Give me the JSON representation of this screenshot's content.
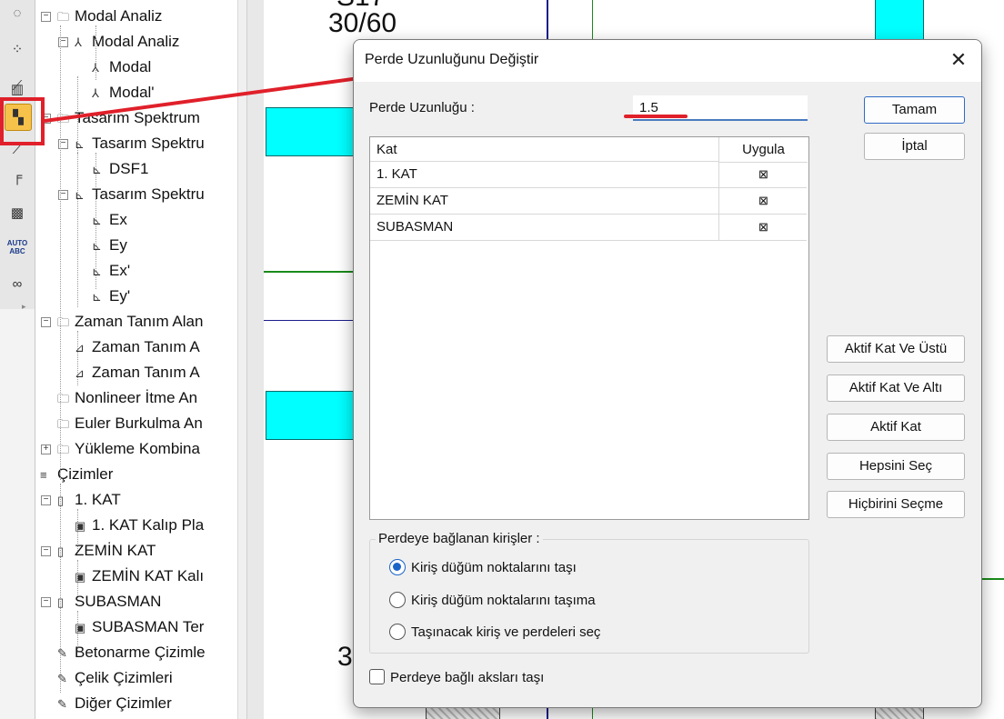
{
  "tree": [
    {
      "label": "Modal Analiz",
      "indent": 1,
      "icon": "folder-icon",
      "expander": "⊟"
    },
    {
      "label": "Modal Analiz",
      "indent": 2,
      "icon": "modal-icon",
      "expander": "⊟"
    },
    {
      "label": "Modal",
      "indent": 3,
      "icon": "modal-icon",
      "expander": ""
    },
    {
      "label": "Modal'",
      "indent": 3,
      "icon": "modal-icon",
      "expander": ""
    },
    {
      "label": "Tasarım Spektrum",
      "indent": 1,
      "icon": "folder-icon",
      "expander": "⊟"
    },
    {
      "label": "Tasarım Spektru",
      "indent": 2,
      "icon": "spectrum-icon",
      "expander": "⊟"
    },
    {
      "label": "DSF1",
      "indent": 3,
      "icon": "spectrum-icon",
      "expander": ""
    },
    {
      "label": "Tasarım Spektru",
      "indent": 2,
      "icon": "spectrum-icon",
      "expander": "⊟"
    },
    {
      "label": "Ex",
      "indent": 3,
      "icon": "spectrum-icon",
      "expander": ""
    },
    {
      "label": "Ey",
      "indent": 3,
      "icon": "spectrum-icon",
      "expander": ""
    },
    {
      "label": "Ex'",
      "indent": 3,
      "icon": "spectrum-icon",
      "expander": ""
    },
    {
      "label": "Ey'",
      "indent": 3,
      "icon": "spectrum-icon",
      "expander": ""
    },
    {
      "label": "Zaman Tanım Alan",
      "indent": 1,
      "icon": "folder-icon",
      "expander": "⊟"
    },
    {
      "label": "Zaman Tanım A",
      "indent": 2,
      "icon": "time-icon",
      "expander": ""
    },
    {
      "label": "Zaman Tanım A",
      "indent": 2,
      "icon": "time-icon",
      "expander": ""
    },
    {
      "label": "Nonlineer İtme An",
      "indent": 1,
      "icon": "folder-icon",
      "expander": ""
    },
    {
      "label": "Euler Burkulma An",
      "indent": 1,
      "icon": "folder-icon",
      "expander": ""
    },
    {
      "label": "Yükleme Kombina",
      "indent": 1,
      "icon": "folder-icon",
      "expander": "⊞"
    },
    {
      "label": "Çizimler",
      "indent": 0,
      "icon": "drawings-icon",
      "expander": "⊟"
    },
    {
      "label": "1. KAT",
      "indent": 1,
      "icon": "page-icon",
      "expander": "⊟"
    },
    {
      "label": "1. KAT Kalıp Pla",
      "indent": 2,
      "icon": "plan-icon",
      "expander": ""
    },
    {
      "label": "ZEMİN KAT",
      "indent": 1,
      "icon": "page-icon",
      "expander": "⊟"
    },
    {
      "label": "ZEMİN KAT Kalı",
      "indent": 2,
      "icon": "plan-icon",
      "expander": ""
    },
    {
      "label": "SUBASMAN",
      "indent": 1,
      "icon": "page-icon",
      "expander": "⊟"
    },
    {
      "label": "SUBASMAN Ter",
      "indent": 2,
      "icon": "plan-icon",
      "expander": ""
    },
    {
      "label": "Betonarme Çizimle",
      "indent": 1,
      "icon": "pen-icon",
      "expander": ""
    },
    {
      "label": "Çelik Çizimleri",
      "indent": 1,
      "icon": "pen-icon",
      "expander": ""
    },
    {
      "label": "Diğer Çizimler",
      "indent": 1,
      "icon": "pen-icon",
      "expander": ""
    }
  ],
  "canvas": {
    "label_top": "30/60",
    "label_top_partial": "S17",
    "label_bottom_partial": "3"
  },
  "toolbar": {
    "icons": [
      "orbit-icon",
      "nodes-icon",
      "scale-icon",
      "grid-icon",
      "wall-length-icon",
      "line-icon",
      "beam-icon",
      "tools-icon",
      "auto-abc-icon",
      "binoculars-icon"
    ],
    "auto_label": "AUTO ABC"
  },
  "dialog": {
    "title": "Perde Uzunluğunu Değiştir",
    "close_glyph": "✕",
    "length_label": "Perde Uzunluğu :",
    "length_value": "1.5",
    "list_header_kat": "Kat",
    "list_header_uygula": "Uygula",
    "rows": [
      {
        "kat": "1. KAT",
        "uygula": "⊠"
      },
      {
        "kat": "ZEMİN KAT",
        "uygula": "⊠"
      },
      {
        "kat": "SUBASMAN",
        "uygula": "⊠"
      }
    ],
    "buttons": {
      "ok": "Tamam",
      "cancel": "İptal",
      "active_and_above": "Aktif Kat Ve Üstü",
      "active_and_below": "Aktif Kat Ve Altı",
      "active": "Aktif Kat",
      "select_all": "Hepsini Seç",
      "select_none": "Hiçbirini Seçme"
    },
    "group_title": "Perdeye bağlanan kirişler :",
    "radios": [
      {
        "label": "Kiriş düğüm noktalarını taşı",
        "selected": true
      },
      {
        "label": "Kiriş düğüm noktalarını taşıma",
        "selected": false
      },
      {
        "label": "Taşınacak kiriş ve perdeleri seç",
        "selected": false
      }
    ],
    "checkbox_label": "Perdeye bağlı aksları taşı",
    "checkbox_checked": false
  },
  "colors": {
    "accent": "#2f6bc4",
    "annotation_red": "#e0202a",
    "wall_cyan": "#00ffff",
    "axis_green": "#1a8a1a",
    "axis_navy": "#1c1c8c"
  }
}
